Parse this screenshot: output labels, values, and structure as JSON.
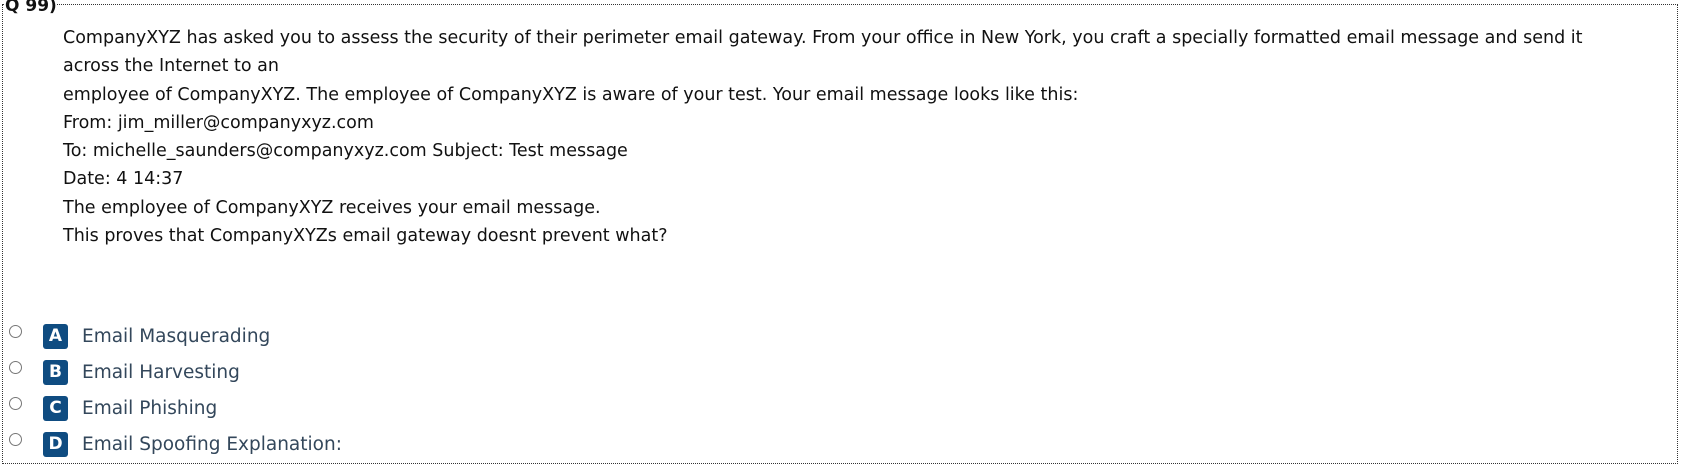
{
  "question": {
    "number": "Q 99)",
    "lines": [
      "CompanyXYZ has asked you to assess the security of their perimeter email gateway. From your office in New York, you craft a specially formatted email message and send it",
      "across the Internet to an",
      "employee of CompanyXYZ. The employee of CompanyXYZ is aware of your test. Your email message looks like this:",
      "From: jim_miller@companyxyz.com",
      "To: michelle_saunders@companyxyz.com Subject: Test message",
      "Date: 4 14:37",
      "The employee of CompanyXYZ receives your email message.",
      "This proves that CompanyXYZs email gateway doesnt prevent what?"
    ]
  },
  "options": [
    {
      "letter": "A",
      "text": "Email Masquerading"
    },
    {
      "letter": "B",
      "text": "Email Harvesting"
    },
    {
      "letter": "C",
      "text": "Email Phishing"
    },
    {
      "letter": "D",
      "text": "Email Spoofing Explanation:"
    }
  ],
  "colors": {
    "badge": "#0f4c81",
    "option_text": "#33475b"
  }
}
